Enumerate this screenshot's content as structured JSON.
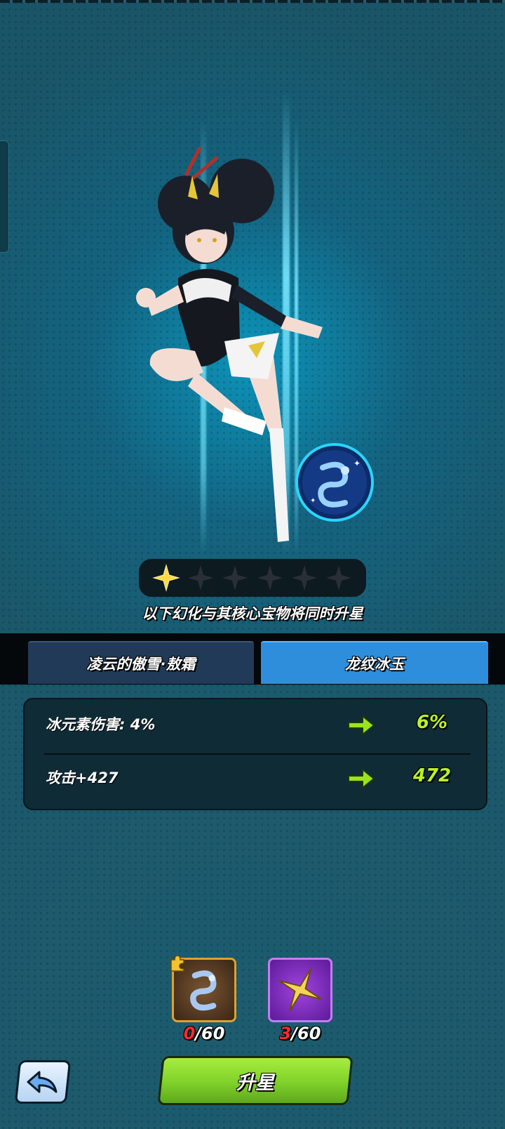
{
  "stars": {
    "filled": 1,
    "total": 6
  },
  "upgrade_note": "以下幻化与其核心宝物将同时升星",
  "tabs": [
    {
      "label": "凌云的傲雪·敖霜",
      "active": false
    },
    {
      "label": "龙纹冰玉",
      "active": true
    }
  ],
  "stats": [
    {
      "label": "冰元素伤害: 4%",
      "next": "6%"
    },
    {
      "label": "攻击+427",
      "next": "472"
    }
  ],
  "materials": [
    {
      "icon": "dragon-jade-icon",
      "have": "0",
      "need": "/60"
    },
    {
      "icon": "star-stone-icon",
      "have": "3",
      "need": "/60"
    }
  ],
  "buttons": {
    "back_icon": "back-arrow-icon",
    "upgrade": "升星"
  },
  "colors": {
    "accent_green": "#b8f227",
    "tab_active": "#2e8edc",
    "tab_inactive": "#213a58",
    "count_short": "#ff2a2a"
  }
}
